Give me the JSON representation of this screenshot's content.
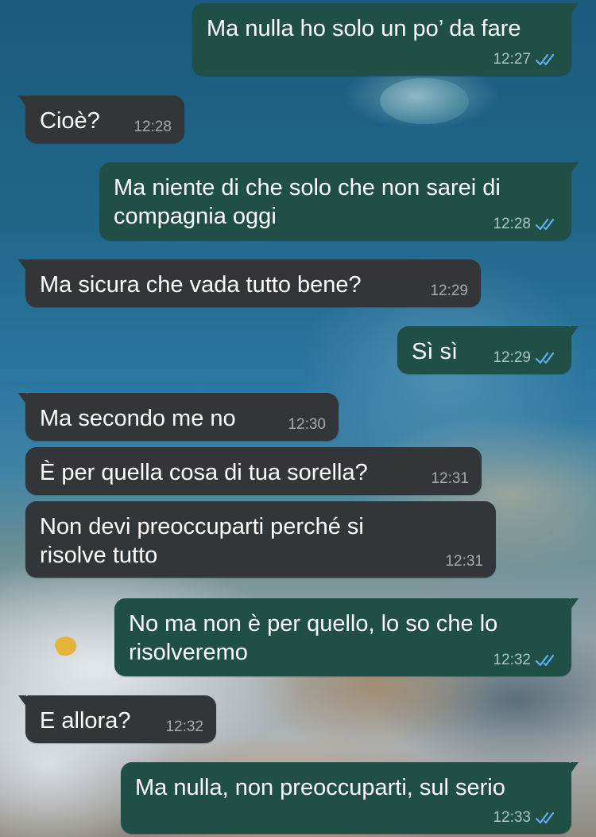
{
  "chat": {
    "messages": [
      {
        "direction": "out",
        "text": [
          "Ma nulla ho solo un po’ da fare"
        ],
        "time": "12:27",
        "status": "read"
      },
      {
        "direction": "in",
        "text": [
          "Cioè?"
        ],
        "time": "12:28"
      },
      {
        "direction": "out",
        "text": [
          "Ma niente di che solo che non sarei di",
          "compagnia oggi"
        ],
        "time": "12:28",
        "status": "read"
      },
      {
        "direction": "in",
        "text": [
          "Ma sicura che vada tutto bene?"
        ],
        "time": "12:29"
      },
      {
        "direction": "out",
        "text": [
          "Sì sì"
        ],
        "time": "12:29",
        "status": "read"
      },
      {
        "direction": "in",
        "text": [
          "Ma secondo me no"
        ],
        "time": "12:30"
      },
      {
        "direction": "in",
        "text": [
          "È per quella cosa di tua sorella?"
        ],
        "time": "12:31"
      },
      {
        "direction": "in",
        "text": [
          "Non devi preoccuparti perché si",
          "risolve tutto"
        ],
        "time": "12:31"
      },
      {
        "direction": "out",
        "text": [
          "No ma non è per quello, lo so che lo",
          "risolveremo"
        ],
        "time": "12:32",
        "status": "read"
      },
      {
        "direction": "in",
        "text": [
          "E allora?"
        ],
        "time": "12:32"
      },
      {
        "direction": "out",
        "text": [
          "Ma nulla, non preoccuparti, sul serio"
        ],
        "time": "12:33",
        "status": "read"
      }
    ]
  },
  "colors": {
    "outgoing_bubble": "#1f4f45",
    "incoming_bubble": "#333638",
    "read_ticks": "#5fb0f0",
    "text": "#ffffff"
  },
  "icons": {
    "read_receipt": "double-check-icon"
  }
}
